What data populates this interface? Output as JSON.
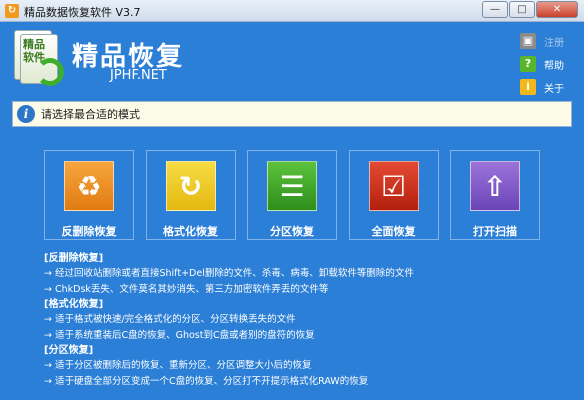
{
  "window": {
    "title": "精品数据恢复软件 V3.7",
    "icon": "app-logo-icon",
    "controls": [
      "minimize",
      "maximize",
      "close"
    ]
  },
  "header": {
    "logo_text": "精品软件",
    "app_name": "精品恢复",
    "url": "JPHF.NET"
  },
  "side_menu": [
    {
      "icon": "cart-icon",
      "label": "注册",
      "dim": true
    },
    {
      "icon": "help-icon",
      "label": "帮助",
      "dim": false
    },
    {
      "icon": "info-icon",
      "label": "关于",
      "dim": false
    }
  ],
  "hint": {
    "text": "请选择最合适的模式"
  },
  "modes": [
    {
      "label": "反删除恢复",
      "icon": "recycle-icon",
      "color": "#e98a1f"
    },
    {
      "label": "格式化恢复",
      "icon": "undo-icon",
      "color": "#eec62a"
    },
    {
      "label": "分区恢复",
      "icon": "checklist-icon",
      "color": "#43a82b"
    },
    {
      "label": "全面恢复",
      "icon": "checkbox-icon",
      "color": "#cc3320"
    },
    {
      "label": "打开扫描",
      "icon": "upload-arrow-icon",
      "color": "#8460c9"
    }
  ],
  "descriptions": [
    {
      "title": "[反删除恢复]",
      "lines": [
        "→ 经过回收站删除或者直接Shift+Del删除的文件、杀毒、病毒、卸载软件等删除的文件",
        "→ ChkDsk丢失、文件莫名其妙消失、第三方加密软件弄丢的文件等"
      ]
    },
    {
      "title": "[格式化恢复]",
      "lines": [
        "→ 适于格式被快速/完全格式化的分区、分区转换丢失的文件",
        "→ 适于系统重装后C盘的恢复、Ghost到C盘或者别的盘符的恢复"
      ]
    },
    {
      "title": "[分区恢复]",
      "lines": [
        "→ 适于分区被删除后的恢复、重新分区、分区调整大小后的恢复",
        "→ 适于硬盘全部分区变成一个C盘的恢复、分区打不开提示格式化RAW的恢复"
      ]
    }
  ]
}
